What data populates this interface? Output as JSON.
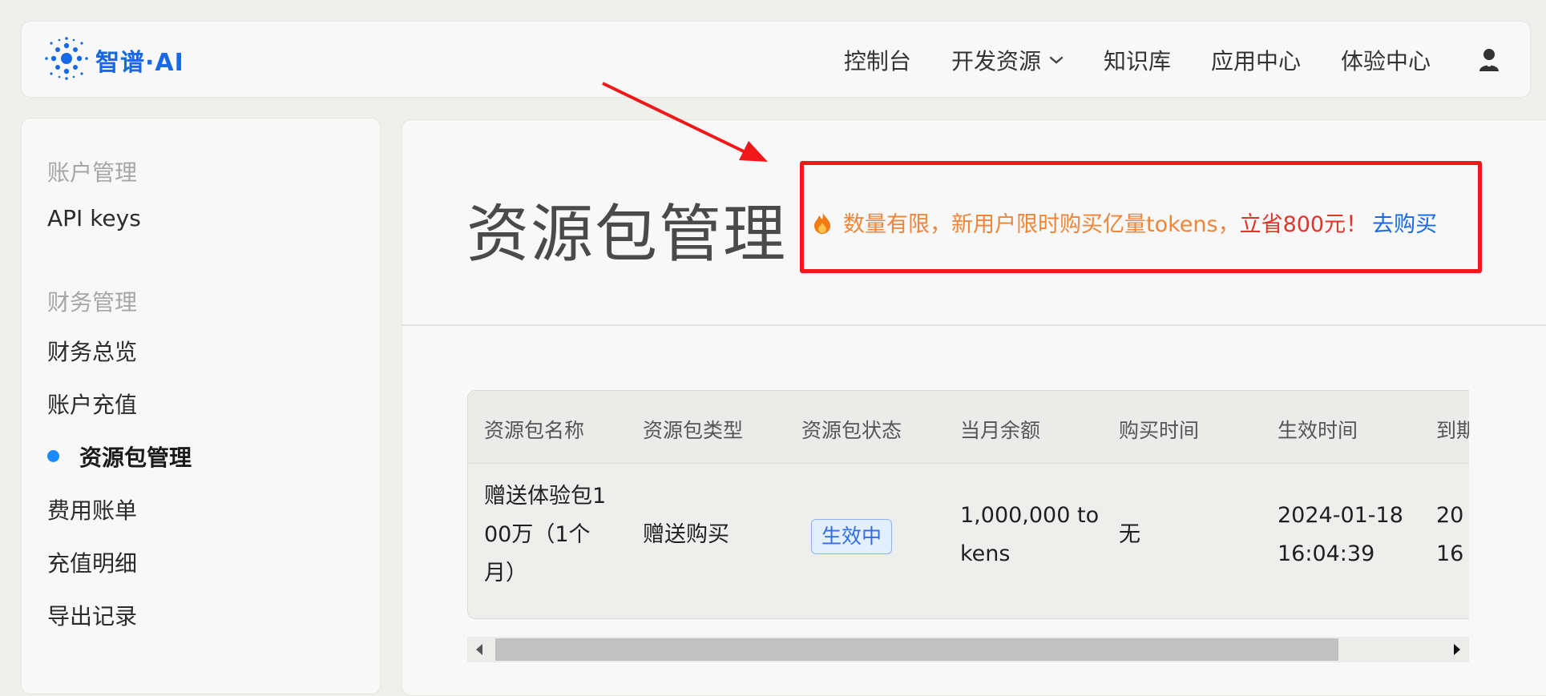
{
  "header": {
    "logo_text": "智谱·AI",
    "nav": [
      {
        "label": "控制台"
      },
      {
        "label": "开发资源"
      },
      {
        "label": "知识库"
      },
      {
        "label": "应用中心"
      },
      {
        "label": "体验中心"
      }
    ]
  },
  "sidebar": {
    "group1": "账户管理",
    "api_keys": "API keys",
    "group2": "财务管理",
    "items": [
      "财务总览",
      "账户充值",
      "资源包管理",
      "费用账单",
      "充值明细",
      "导出记录"
    ]
  },
  "main": {
    "title": "资源包管理",
    "promo": {
      "part1": "数量有限，新用户限时购买亿量tokens，",
      "part2": "立省800元！",
      "link": "去购买"
    },
    "table": {
      "headers": [
        "资源包名称",
        "资源包类型",
        "资源包状态",
        "当月余额",
        "购买时间",
        "生效时间",
        "到期"
      ],
      "row": {
        "name_l1": "赠送体验包1",
        "name_l2": "00万（1个",
        "name_l3": "月）",
        "type": "赠送购买",
        "status": "生效中",
        "balance_l1": "1,000,000 to",
        "balance_l2": "kens",
        "purchase_time": "无",
        "effective_date": "2024-01-18",
        "effective_time": "16:04:39",
        "expire_date": "20",
        "expire_time": "16"
      }
    }
  },
  "colors": {
    "accent": "#1769e6",
    "promo_border": "#f01818",
    "promo_orange": "#f0853a",
    "promo_red": "#e2352a",
    "active_dot": "#1a8cff"
  },
  "icons": [
    "logo-icon",
    "chevron-down-icon",
    "user-icon",
    "fire-icon",
    "scroll-left-icon",
    "scroll-right-icon",
    "annotation-arrow"
  ]
}
